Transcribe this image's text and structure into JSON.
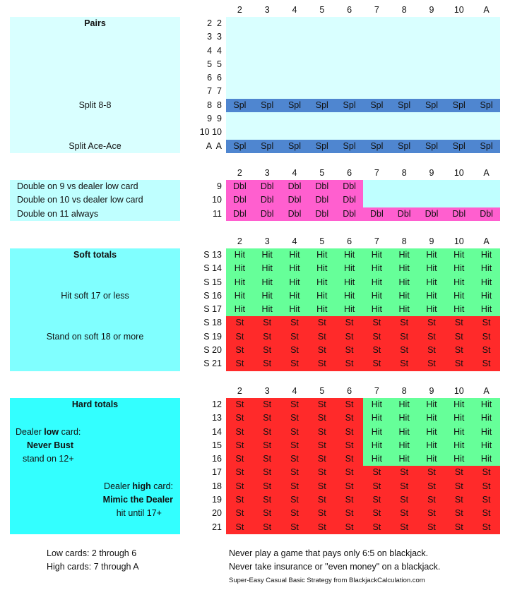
{
  "dealer_cards": [
    "2",
    "3",
    "4",
    "5",
    "6",
    "7",
    "8",
    "9",
    "10",
    "A"
  ],
  "colors": {
    "pairs_bg": "#d9ffff",
    "split": "#4f86d0",
    "double": "#ff5fcf",
    "doubles_panel": "#bfffff",
    "soft_panel": "#80ffff",
    "hard_panel": "#33ffff",
    "hit": "#66ff99",
    "stand": "#ff2a2a",
    "empty": "#bfffff"
  },
  "pairs": {
    "panel_title": "Pairs",
    "notes": [
      "Split 8-8",
      "Split Ace-Ace"
    ],
    "rows": [
      {
        "label": "2  2",
        "cells": [
          "",
          "",
          "",
          "",
          "",
          "",
          "",
          "",
          "",
          ""
        ]
      },
      {
        "label": "3  3",
        "cells": [
          "",
          "",
          "",
          "",
          "",
          "",
          "",
          "",
          "",
          ""
        ]
      },
      {
        "label": "4  4",
        "cells": [
          "",
          "",
          "",
          "",
          "",
          "",
          "",
          "",
          "",
          ""
        ]
      },
      {
        "label": "5  5",
        "cells": [
          "",
          "",
          "",
          "",
          "",
          "",
          "",
          "",
          "",
          ""
        ]
      },
      {
        "label": "6  6",
        "cells": [
          "",
          "",
          "",
          "",
          "",
          "",
          "",
          "",
          "",
          ""
        ]
      },
      {
        "label": "7  7",
        "cells": [
          "",
          "",
          "",
          "",
          "",
          "",
          "",
          "",
          "",
          ""
        ]
      },
      {
        "label": "8  8",
        "cells": [
          "Spl",
          "Spl",
          "Spl",
          "Spl",
          "Spl",
          "Spl",
          "Spl",
          "Spl",
          "Spl",
          "Spl"
        ]
      },
      {
        "label": "9  9",
        "cells": [
          "",
          "",
          "",
          "",
          "",
          "",
          "",
          "",
          "",
          ""
        ]
      },
      {
        "label": "10 10",
        "cells": [
          "",
          "",
          "",
          "",
          "",
          "",
          "",
          "",
          "",
          ""
        ]
      },
      {
        "label": "A  A",
        "cells": [
          "Spl",
          "Spl",
          "Spl",
          "Spl",
          "Spl",
          "Spl",
          "Spl",
          "Spl",
          "Spl",
          "Spl"
        ]
      }
    ]
  },
  "doubles": {
    "notes": [
      "Double on  9  vs dealer low card",
      "Double on 10 vs dealer low card",
      "Double on 11 always"
    ],
    "rows": [
      {
        "label": "9",
        "cells": [
          "Dbl",
          "Dbl",
          "Dbl",
          "Dbl",
          "Dbl",
          "",
          "",
          "",
          "",
          ""
        ]
      },
      {
        "label": "10",
        "cells": [
          "Dbl",
          "Dbl",
          "Dbl",
          "Dbl",
          "Dbl",
          "",
          "",
          "",
          "",
          ""
        ]
      },
      {
        "label": "11",
        "cells": [
          "Dbl",
          "Dbl",
          "Dbl",
          "Dbl",
          "Dbl",
          "Dbl",
          "Dbl",
          "Dbl",
          "Dbl",
          "Dbl"
        ]
      }
    ]
  },
  "soft": {
    "panel_title": "Soft totals",
    "notes": [
      "Hit soft 17 or less",
      "Stand on soft 18 or more"
    ],
    "rows": [
      {
        "label": "S 13",
        "cells": [
          "Hit",
          "Hit",
          "Hit",
          "Hit",
          "Hit",
          "Hit",
          "Hit",
          "Hit",
          "Hit",
          "Hit"
        ]
      },
      {
        "label": "S 14",
        "cells": [
          "Hit",
          "Hit",
          "Hit",
          "Hit",
          "Hit",
          "Hit",
          "Hit",
          "Hit",
          "Hit",
          "Hit"
        ]
      },
      {
        "label": "S 15",
        "cells": [
          "Hit",
          "Hit",
          "Hit",
          "Hit",
          "Hit",
          "Hit",
          "Hit",
          "Hit",
          "Hit",
          "Hit"
        ]
      },
      {
        "label": "S 16",
        "cells": [
          "Hit",
          "Hit",
          "Hit",
          "Hit",
          "Hit",
          "Hit",
          "Hit",
          "Hit",
          "Hit",
          "Hit"
        ]
      },
      {
        "label": "S 17",
        "cells": [
          "Hit",
          "Hit",
          "Hit",
          "Hit",
          "Hit",
          "Hit",
          "Hit",
          "Hit",
          "Hit",
          "Hit"
        ]
      },
      {
        "label": "S 18",
        "cells": [
          "St",
          "St",
          "St",
          "St",
          "St",
          "St",
          "St",
          "St",
          "St",
          "St"
        ]
      },
      {
        "label": "S 19",
        "cells": [
          "St",
          "St",
          "St",
          "St",
          "St",
          "St",
          "St",
          "St",
          "St",
          "St"
        ]
      },
      {
        "label": "S 20",
        "cells": [
          "St",
          "St",
          "St",
          "St",
          "St",
          "St",
          "St",
          "St",
          "St",
          "St"
        ]
      },
      {
        "label": "S 21",
        "cells": [
          "St",
          "St",
          "St",
          "St",
          "St",
          "St",
          "St",
          "St",
          "St",
          "St"
        ]
      }
    ]
  },
  "hard": {
    "panel_title": "Hard totals",
    "low": {
      "prefix": "Dealer ",
      "bold": "low",
      "suffix": " card:",
      "line2": "Never Bust",
      "line3": "stand on 12+"
    },
    "high": {
      "prefix": "Dealer ",
      "bold": "high",
      "suffix": " card:",
      "line2": "Mimic the Dealer",
      "line3": "hit until 17+"
    },
    "rows": [
      {
        "label": "12",
        "cells": [
          "St",
          "St",
          "St",
          "St",
          "St",
          "Hit",
          "Hit",
          "Hit",
          "Hit",
          "Hit"
        ]
      },
      {
        "label": "13",
        "cells": [
          "St",
          "St",
          "St",
          "St",
          "St",
          "Hit",
          "Hit",
          "Hit",
          "Hit",
          "Hit"
        ]
      },
      {
        "label": "14",
        "cells": [
          "St",
          "St",
          "St",
          "St",
          "St",
          "Hit",
          "Hit",
          "Hit",
          "Hit",
          "Hit"
        ]
      },
      {
        "label": "15",
        "cells": [
          "St",
          "St",
          "St",
          "St",
          "St",
          "Hit",
          "Hit",
          "Hit",
          "Hit",
          "Hit"
        ]
      },
      {
        "label": "16",
        "cells": [
          "St",
          "St",
          "St",
          "St",
          "St",
          "Hit",
          "Hit",
          "Hit",
          "Hit",
          "Hit"
        ]
      },
      {
        "label": "17",
        "cells": [
          "St",
          "St",
          "St",
          "St",
          "St",
          "St",
          "St",
          "St",
          "St",
          "St"
        ]
      },
      {
        "label": "18",
        "cells": [
          "St",
          "St",
          "St",
          "St",
          "St",
          "St",
          "St",
          "St",
          "St",
          "St"
        ]
      },
      {
        "label": "19",
        "cells": [
          "St",
          "St",
          "St",
          "St",
          "St",
          "St",
          "St",
          "St",
          "St",
          "St"
        ]
      },
      {
        "label": "20",
        "cells": [
          "St",
          "St",
          "St",
          "St",
          "St",
          "St",
          "St",
          "St",
          "St",
          "St"
        ]
      },
      {
        "label": "21",
        "cells": [
          "St",
          "St",
          "St",
          "St",
          "St",
          "St",
          "St",
          "St",
          "St",
          "St"
        ]
      }
    ]
  },
  "footer": {
    "low_cards": "Low cards: 2 through 6",
    "high_cards": "High cards: 7 through A",
    "tip1": "Never play a game that pays only 6:5 on blackjack.",
    "tip2": "Never take insurance or \"even money\" on a blackjack.",
    "credit": "Super-Easy Casual Basic Strategy from BlackjackCalculation.com"
  }
}
